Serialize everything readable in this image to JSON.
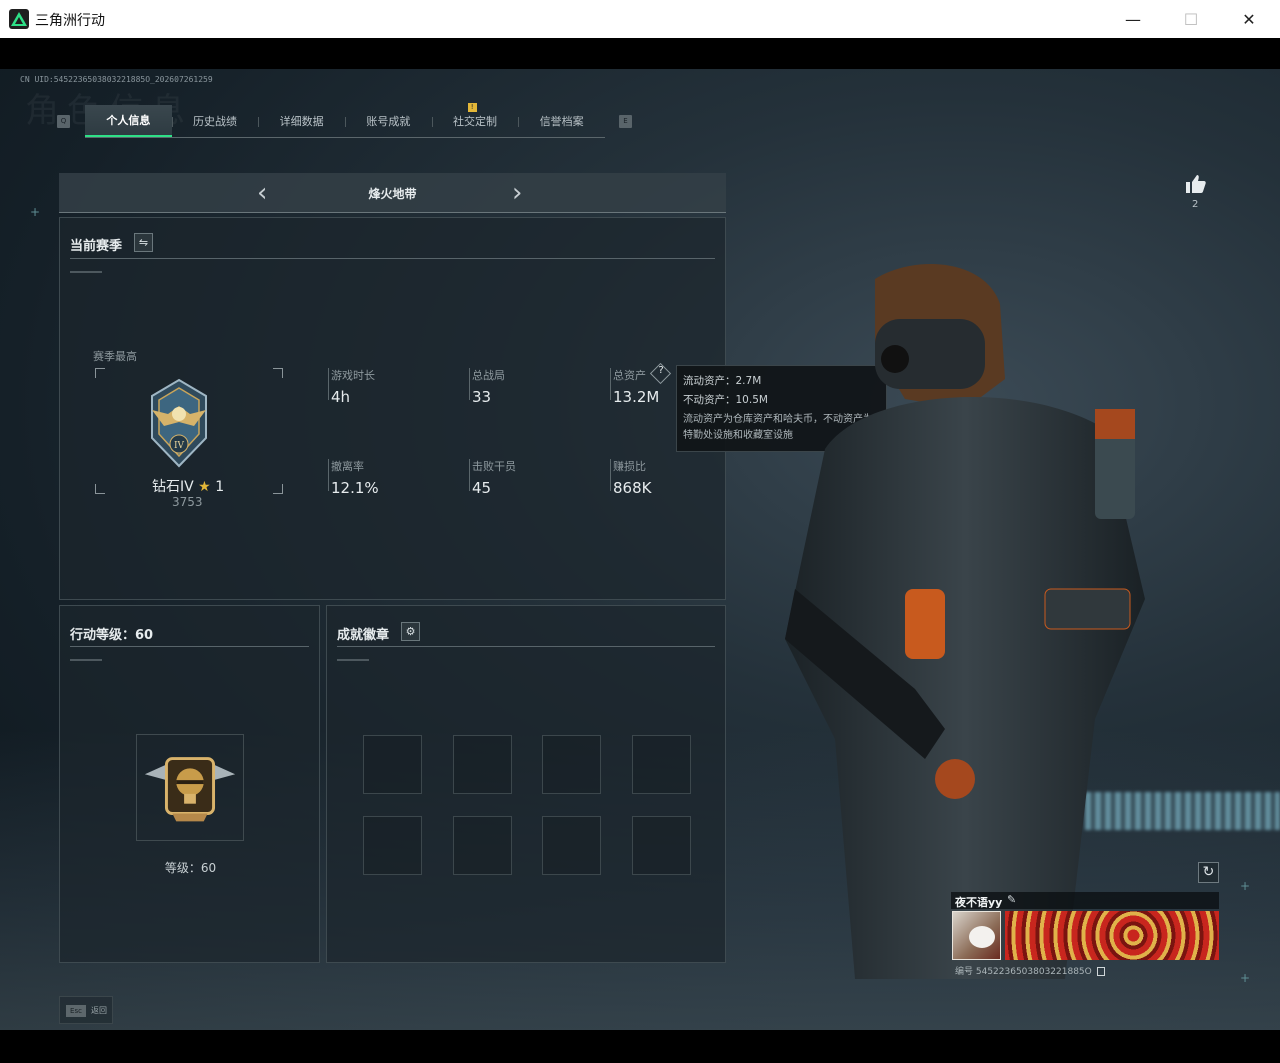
{
  "window": {
    "title": "三角洲行动",
    "minimize": "—",
    "maximize": "☐",
    "close": "✕"
  },
  "header": {
    "uid": "CN UID:5452236503803221885O_202607261259",
    "watermark": "角色信息",
    "key_left": "Q",
    "key_right": "E",
    "tabs": [
      {
        "label": "个人信息",
        "active": true
      },
      {
        "label": "历史战绩"
      },
      {
        "label": "详细数据"
      },
      {
        "label": "账号成就"
      },
      {
        "label": "社交定制",
        "badge": "!"
      },
      {
        "label": "信誉档案"
      }
    ]
  },
  "mode": {
    "title": "烽火地带",
    "prev": "‹",
    "next": "›"
  },
  "season": {
    "title": "当前赛季",
    "switch_icon": "⇋",
    "best_label": "赛季最高",
    "rank_name": "钻石IV",
    "rank_star": "★",
    "rank_stars": "1",
    "rank_score": "3753",
    "stats": [
      {
        "label": "游戏时长",
        "value": "4h"
      },
      {
        "label": "总战局",
        "value": "33"
      },
      {
        "label": "总资产",
        "value": "13.2M",
        "help": "?"
      },
      {
        "label": "撤离率",
        "value": "12.1%"
      },
      {
        "label": "击败干员",
        "value": "45"
      },
      {
        "label": "赚损比",
        "value": "868K"
      }
    ]
  },
  "tooltip": {
    "line1": "流动资产：2.7M",
    "line2": "不动资产：10.5M",
    "note": "流动资产为仓库资产和哈夫币，不动资产为特勤处设施和收藏室设施"
  },
  "level": {
    "title": "行动等级：60",
    "caption": "等级：60"
  },
  "achievements": {
    "title": "成就徽章",
    "gear_icon": "⚙"
  },
  "like": {
    "count": "2"
  },
  "profile": {
    "name": "夜不语yy",
    "edit_icon": "✎",
    "id_label": "编号 5452236503803221885O",
    "refresh_icon": "↻"
  },
  "esc": {
    "key": "Esc",
    "label": "返回"
  },
  "colors": {
    "accent": "#2ee087",
    "badge": "#e3b738"
  }
}
